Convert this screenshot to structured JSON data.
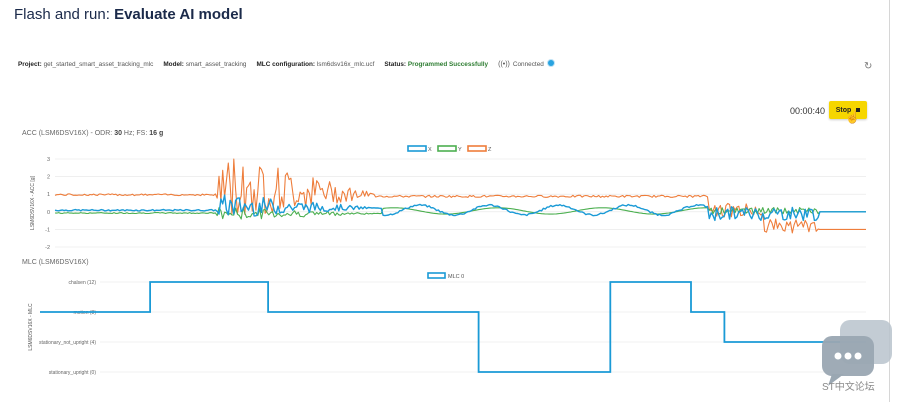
{
  "page": {
    "title_prefix": "Flash and run: ",
    "title_bold": "Evaluate AI model"
  },
  "info_bar": {
    "project_label": "Project:",
    "project_value": "get_started_smart_asset_tracking_mlc",
    "model_label": "Model:",
    "model_value": "smart_asset_tracking",
    "mlc_label": "MLC configuration:",
    "mlc_value": "lsm6dsv16x_mlc.ucf",
    "status_label": "Status:",
    "status_value": "Programmed Successfully",
    "connection_icon": "broadcast-icon",
    "connection_value": "Connected",
    "status_color": "#2e7d32",
    "connection_dot_color": "#29a3e0"
  },
  "controls": {
    "timer": "00:00:40",
    "stop_label": "Stop",
    "stop_color": "#f6d600",
    "refresh_icon": "refresh-icon"
  },
  "acc_chart": {
    "title_prefix": "ACC (LSM6DSV16X) - ODR: ",
    "odr_value": "30",
    "odr_unit": " Hz; FS: ",
    "fs_value": "16 g"
  },
  "mlc_chart": {
    "title": "MLC (LSM6DSV16X)"
  },
  "watermark": {
    "text": "ST中文论坛"
  },
  "chart_data": [
    {
      "type": "line",
      "ylabel": "LSM6DSV16X - ACC [g]",
      "yticks": [
        "3",
        "2",
        "1",
        "0",
        "-1",
        "-2"
      ],
      "ylim": [
        -2,
        3
      ],
      "xlim": [
        0,
        440
      ],
      "legend_position": "top-center",
      "grid": true,
      "series": [
        {
          "name": "X",
          "color": "#1a9ad6"
        },
        {
          "name": "Y",
          "color": "#4caf50"
        },
        {
          "name": "Z",
          "color": "#ee7d3b"
        }
      ]
    },
    {
      "type": "line",
      "ylabel": "LSM6DSV16X - MLC",
      "ytick_labels": [
        "chalsen (12)",
        "motion (8)",
        "stationary_not_upright (4)",
        "stationary_upright (0)"
      ],
      "ytick_values": [
        12,
        8,
        4,
        0
      ],
      "ylim": [
        0,
        12
      ],
      "xlim": [
        0,
        840
      ],
      "legend_position": "top-center",
      "grid": true,
      "series": [
        {
          "name": "MLC 0",
          "color": "#1a9ad6",
          "points": [
            [
              0,
              8
            ],
            [
              112,
              8
            ],
            [
              112,
              12
            ],
            [
              232,
              12
            ],
            [
              232,
              8
            ],
            [
              446,
              8
            ],
            [
              446,
              0
            ],
            [
              580,
              0
            ],
            [
              580,
              12
            ],
            [
              662,
              12
            ],
            [
              662,
              8
            ],
            [
              696,
              8
            ],
            [
              696,
              4
            ],
            [
              840,
              4
            ]
          ]
        }
      ]
    }
  ]
}
